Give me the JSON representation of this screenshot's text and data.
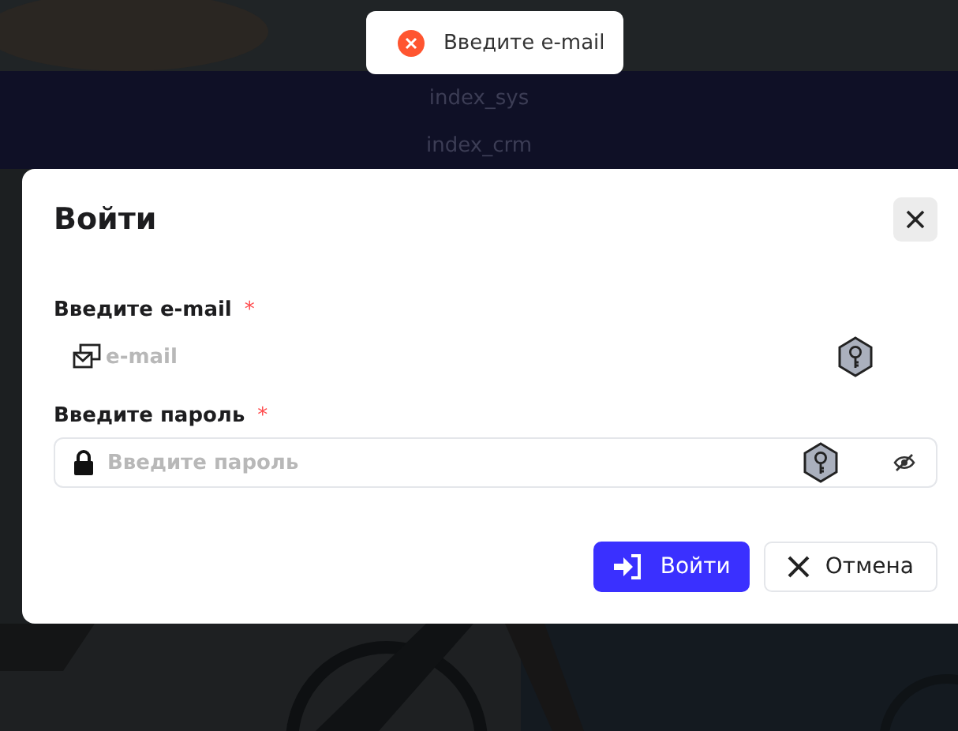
{
  "toast": {
    "kind": "error",
    "message": "Введите e-mail"
  },
  "menu": [
    "index_sys",
    "index_crm"
  ],
  "dialog": {
    "title": "Войти",
    "fields": [
      {
        "kind": "email",
        "label": "Введите e-mail",
        "required_mark": "*",
        "placeholder": "e-mail"
      },
      {
        "kind": "password",
        "label": "Введите пароль",
        "required_mark": "*",
        "placeholder": "Введите пароль"
      }
    ],
    "buttons": [
      {
        "kind": "primary",
        "label": "Войти"
      },
      {
        "kind": "cancel",
        "label": "Отмена"
      }
    ]
  }
}
